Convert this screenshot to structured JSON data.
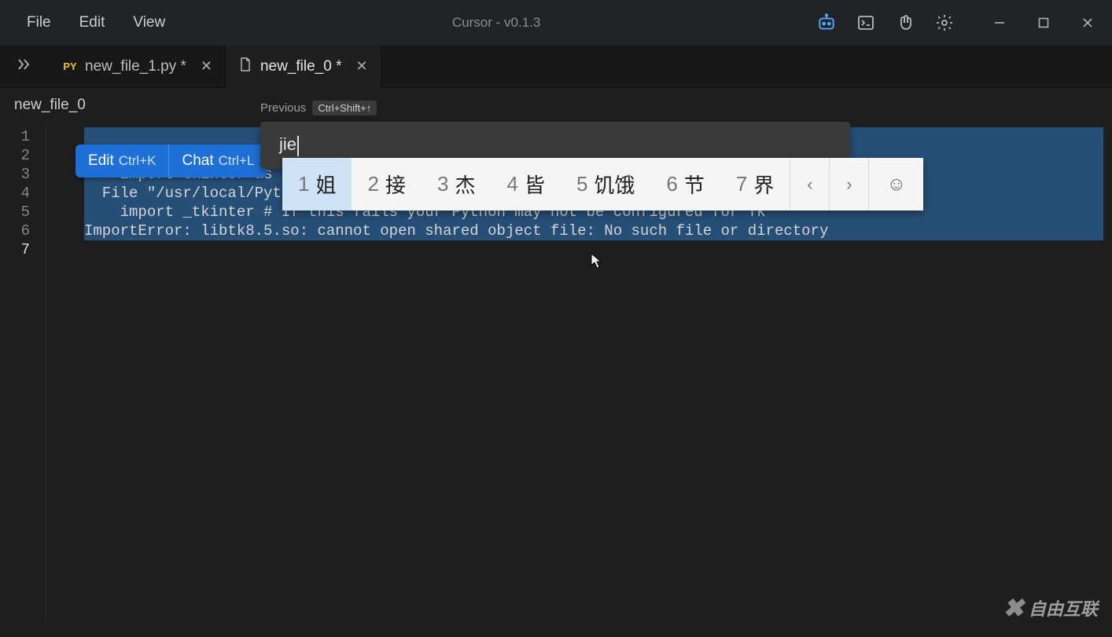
{
  "titlebar": {
    "menus": [
      "File",
      "Edit",
      "View"
    ],
    "title": "Cursor - v0.1.3"
  },
  "tabs": [
    {
      "icon": "PY",
      "label": "new_file_1.py *"
    },
    {
      "icon": "file",
      "label": "new_file_0 *"
    }
  ],
  "breadcrumb": "new_file_0",
  "previous": {
    "label": "Previous",
    "shortcut": "Ctrl+Shift+↑"
  },
  "inline_actions": {
    "edit_label": "Edit",
    "edit_short": "Ctrl+K",
    "chat_label": "Chat",
    "chat_short": "Ctrl+L"
  },
  "search_value": "jie",
  "ime_candidates": [
    {
      "n": "1",
      "t": "姐"
    },
    {
      "n": "2",
      "t": "接"
    },
    {
      "n": "3",
      "t": "杰"
    },
    {
      "n": "4",
      "t": "皆"
    },
    {
      "n": "5",
      "t": "饥饿"
    },
    {
      "n": "6",
      "t": "节"
    },
    {
      "n": "7",
      "t": "界"
    }
  ],
  "line_numbers": [
    "1",
    "2",
    "3",
    "4",
    "5",
    "6",
    "7"
  ],
  "code_lines": [
    "",
    "",
    "    import tkinter as tk",
    "  File \"/usr/local/Pytho",
    "    import _tkinter # If this fails your Python may not be configured for Tk",
    "ImportError: libtk8.5.so: cannot open shared object file: No such file or directory",
    ""
  ],
  "watermark": "自由互联"
}
